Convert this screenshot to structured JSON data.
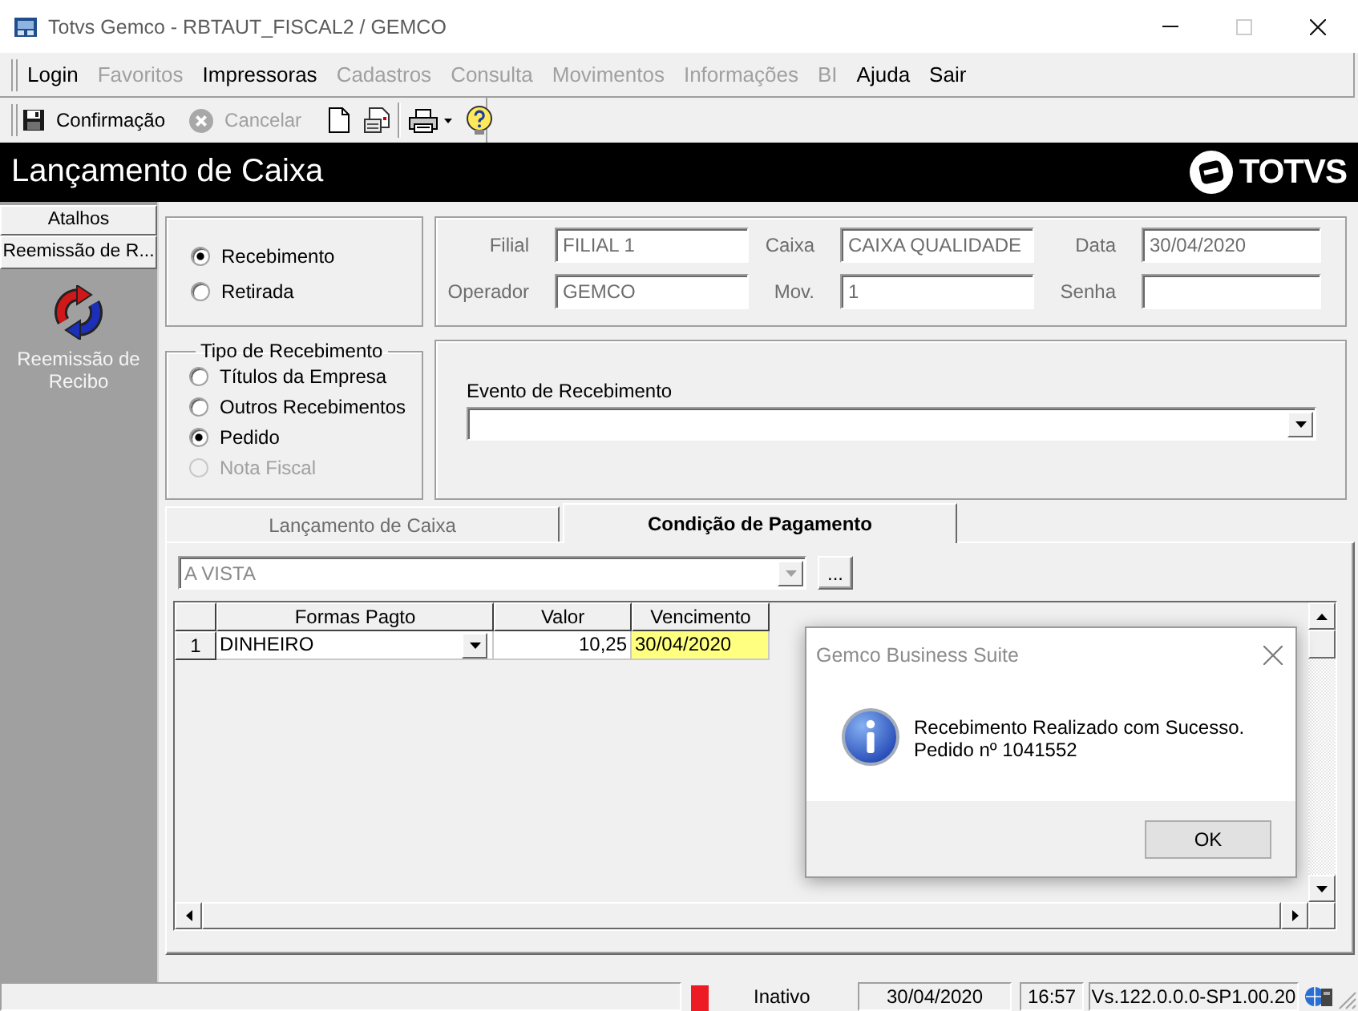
{
  "window": {
    "title": "Totvs Gemco - RBTAUT_FISCAL2 / GEMCO",
    "buttons": [
      {
        "kind": "minimize",
        "disabled": false
      },
      {
        "kind": "maximize",
        "disabled": true
      },
      {
        "kind": "close",
        "disabled": false
      }
    ]
  },
  "menu": [
    {
      "label": "Login",
      "disabled": false
    },
    {
      "label": "Favoritos",
      "disabled": true
    },
    {
      "label": "Impressoras",
      "disabled": false
    },
    {
      "label": "Cadastros",
      "disabled": true
    },
    {
      "label": "Consulta",
      "disabled": true
    },
    {
      "label": "Movimentos",
      "disabled": true
    },
    {
      "label": "Informações",
      "disabled": true
    },
    {
      "label": "BI",
      "disabled": true
    },
    {
      "label": "Ajuda",
      "disabled": false
    },
    {
      "label": "Sair",
      "disabled": false
    }
  ],
  "toolbar": {
    "buttons": [
      {
        "label": "Confirmação",
        "disabled": false
      },
      {
        "label": "Cancelar",
        "disabled": true
      }
    ]
  },
  "header": {
    "title": "Lançamento de Caixa",
    "logo": "TOTVS"
  },
  "sidebar": {
    "sections": [
      "Atalhos",
      "Reemissão de R..."
    ],
    "shortcuts": [
      {
        "label": "Reemissão de Recibo"
      }
    ]
  },
  "operation": [
    {
      "label": "Recebimento",
      "selected": true
    },
    {
      "label": "Retirada",
      "selected": false
    }
  ],
  "fields": [
    {
      "label": "Filial",
      "value": "FILIAL 1"
    },
    {
      "label": "Caixa",
      "value": "CAIXA QUALIDADE"
    },
    {
      "label": "Data",
      "value": "30/04/2020"
    },
    {
      "label": "Operador",
      "value": "GEMCO"
    },
    {
      "label": "Mov.",
      "value": "1"
    },
    {
      "label": "Senha"
    }
  ],
  "receipt_type": {
    "title": "Tipo de Recebimento",
    "options": [
      {
        "label": "Títulos da Empresa",
        "selected": false,
        "disabled": false
      },
      {
        "label": "Outros Recebimentos",
        "selected": false,
        "disabled": false
      },
      {
        "label": "Pedido",
        "selected": true,
        "disabled": false
      },
      {
        "label": "Nota Fiscal",
        "selected": false,
        "disabled": true
      }
    ]
  },
  "event": {
    "label": "Evento de Recebimento"
  },
  "tabs": [
    {
      "label": "Lançamento de Caixa",
      "selected": false
    },
    {
      "label": "Condição de Pagamento",
      "selected": true
    }
  ],
  "payment": {
    "condition": {
      "value": "A VISTA",
      "disabled": true
    },
    "more_button": "...",
    "grid": {
      "columns": [
        "Formas Pagto",
        "Valor",
        "Vencimento"
      ],
      "rows": [
        {
          "number": "1",
          "cells": [
            {
              "kind": "dropdown",
              "text": "DINHEIRO",
              "selected": false
            },
            {
              "kind": "number",
              "text": "10,25",
              "selected": false
            },
            {
              "kind": "text",
              "text": "30/04/2020",
              "selected": true
            }
          ]
        }
      ]
    }
  },
  "dialog": {
    "title": "Gemco Business Suite",
    "message": "Recebimento Realizado com Sucesso.\nPedido nº 1041552",
    "buttons": [
      "OK"
    ]
  },
  "status_bar": {
    "active": false,
    "state": "Inativo",
    "date": "30/04/2020",
    "time": "16:57",
    "version": "Vs.122.0.0.0-SP1.00.20"
  }
}
